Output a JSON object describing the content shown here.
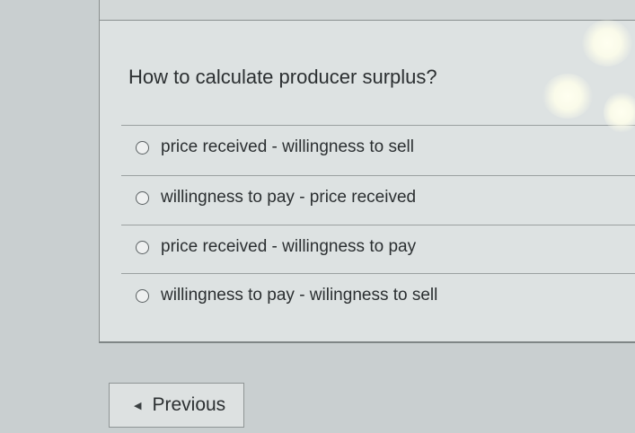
{
  "question": {
    "text": "How to calculate producer surplus?"
  },
  "options": [
    {
      "label": "price received - willingness to sell",
      "selected": false
    },
    {
      "label": "willingness to pay - price received",
      "selected": false
    },
    {
      "label": "price received - willingness to pay",
      "selected": false
    },
    {
      "label": "willingness to pay - wilingness to sell",
      "selected": false
    }
  ],
  "navigation": {
    "previous_label": "Previous",
    "previous_icon": "caret-left-icon"
  }
}
